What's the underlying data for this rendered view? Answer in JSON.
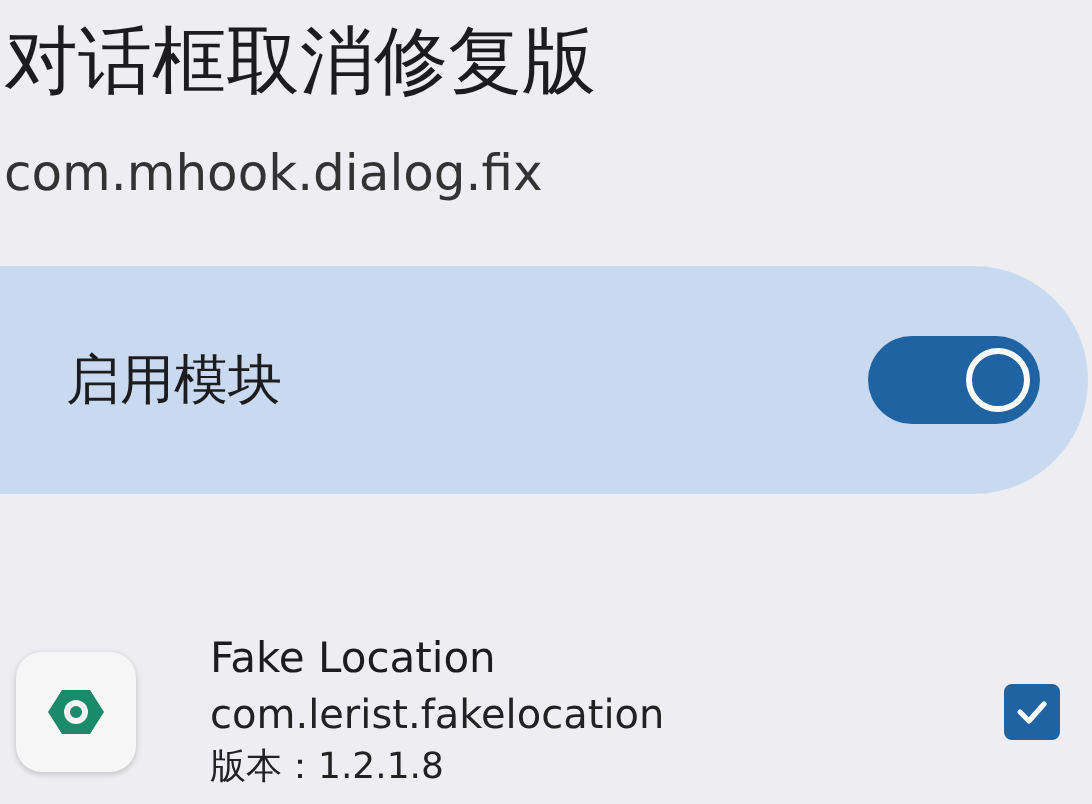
{
  "title": "对话框取消修复版",
  "package": "com.mhook.dialog.fix",
  "module_switch": {
    "label": "启用模块",
    "on": true
  },
  "apps": [
    {
      "name": "Fake Location",
      "package": "com.lerist.fakelocation",
      "version": "版本：1.2.1.8",
      "checked": true
    }
  ]
}
